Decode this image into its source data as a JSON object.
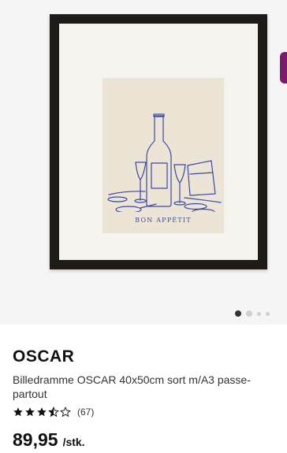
{
  "product": {
    "name": "OSCAR",
    "description": "Billedramme OSCAR 40x50cm sort m/A3 passe-partout",
    "rating": {
      "stars": 3.5,
      "max_stars": 5,
      "count": "(67)"
    },
    "price": {
      "value": "89,95",
      "unit": "/stk."
    }
  },
  "image": {
    "poster_caption": "BON APPÉTIT",
    "frame_color": "#1e1a18",
    "line_art_color": "#3b48a8"
  },
  "gallery": {
    "dot_count": 4,
    "active_index": 0
  },
  "icons": {
    "star_filled": "star-filled-icon",
    "star_half": "star-half-icon",
    "star_empty": "star-empty-icon"
  }
}
